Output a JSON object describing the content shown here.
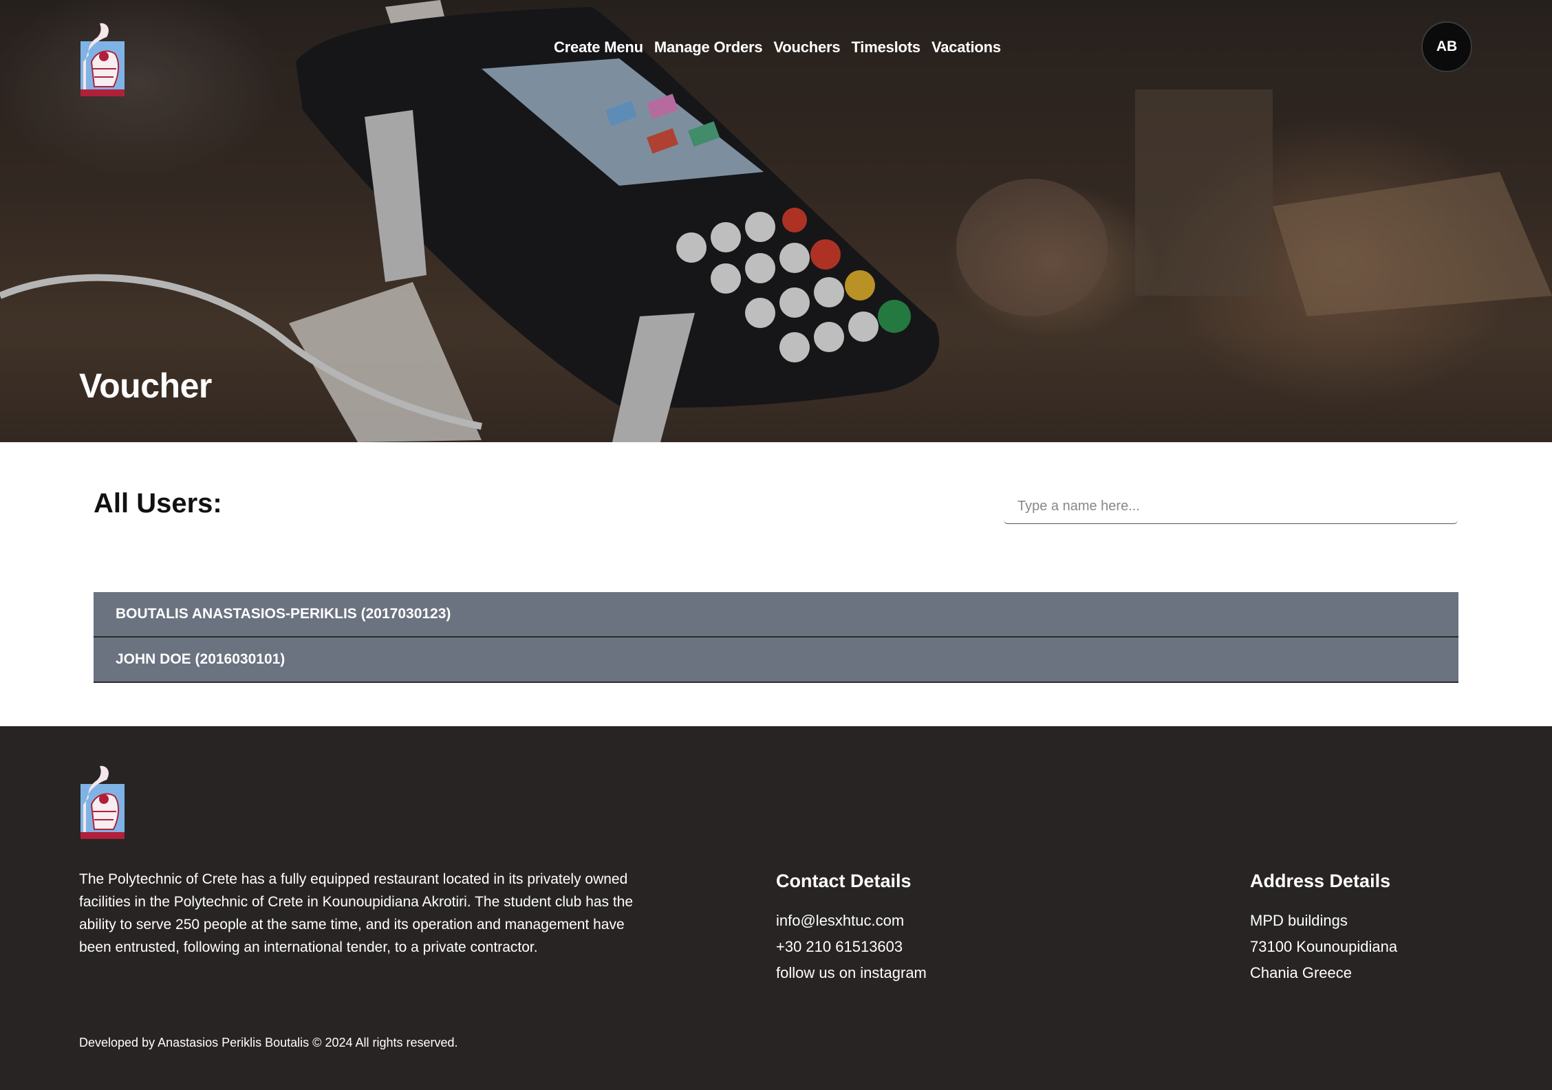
{
  "header": {
    "logo_icon": "polytechnic-crest-icon",
    "nav": [
      {
        "label": "Create Menu"
      },
      {
        "label": "Manage Orders"
      },
      {
        "label": "Vouchers"
      },
      {
        "label": "Timeslots"
      },
      {
        "label": "Vacations"
      }
    ],
    "avatar_initials": "AB",
    "hero_title": "Voucher"
  },
  "main": {
    "title": "All Users:",
    "search": {
      "placeholder": "Type a name here..."
    },
    "users": [
      {
        "label": "BOUTALIS ANASTASIOS-PERIKLIS (2017030123)"
      },
      {
        "label": "JOHN DOE (2016030101)"
      }
    ]
  },
  "footer": {
    "logo_icon": "polytechnic-crest-icon",
    "about": "The Polytechnic of Crete has a fully equipped restaurant located in its privately owned facilities in the Polytechnic of Crete in Kounoupidiana Akrotiri. The student club has the ability to serve 250 people at the same time, and its operation and management have been entrusted, following an international tender, to a private contractor.",
    "contact": {
      "title": "Contact Details",
      "email": "info@lesxhtuc.com",
      "phone": "+30 210 61513603",
      "instagram": "follow us on instagram"
    },
    "address": {
      "title": "Address Details",
      "line1": "MPD buildings",
      "line2": "73100 Kounoupidiana",
      "line3": "Chania Greece"
    },
    "copyright": "Developed by Anastasios Periklis Boutalis © 2024 All rights reserved."
  },
  "colors": {
    "row_bg": "#6b7280",
    "footer_bg": "#282424",
    "avatar_bg": "#0b0b0c"
  }
}
